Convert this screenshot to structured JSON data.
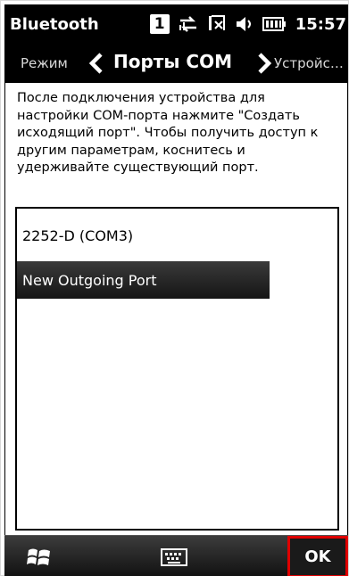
{
  "status_bar": {
    "app_title": "Bluetooth",
    "sim_number": "1",
    "time": "15:57"
  },
  "pivot": {
    "left_label": "Режим",
    "current_label": "Порты COM",
    "right_label": "Устройс…"
  },
  "instructions": "После подключения устройства для настройки COM-порта нажмите \"Создать исходящий порт\". Чтобы получить доступ к другим параметрам, коснитесь и удерживайте существующий порт.",
  "ports": [
    {
      "label": "2252-D (COM3)",
      "selected": false
    },
    {
      "label": "New Outgoing Port",
      "selected": true
    }
  ],
  "command_bar": {
    "ok_label": "OK"
  },
  "icons": [
    "sim-icon",
    "sync-icon",
    "signal-off-icon",
    "volume-off-icon",
    "battery-icon",
    "chevron-left-icon",
    "chevron-right-icon",
    "windows-start-icon",
    "keyboard-icon"
  ],
  "colors": {
    "highlight_border": "#e00000",
    "bar_bg": "#000000"
  }
}
